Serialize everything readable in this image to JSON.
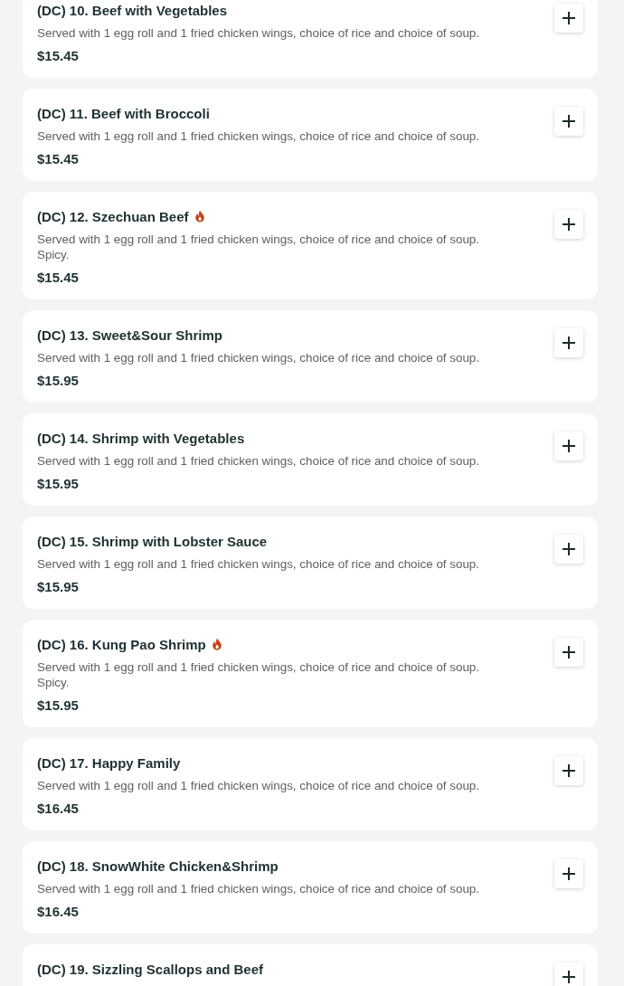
{
  "items": [
    {
      "name": "(DC) 10. Beef with Vegetables",
      "spicy": false,
      "description": "Served with 1 egg roll and 1 fried chicken wings, choice of rice and choice of soup.",
      "price": "$15.45"
    },
    {
      "name": "(DC) 11. Beef with Broccoli",
      "spicy": false,
      "description": "Served with 1 egg roll and 1 fried chicken wings, choice of rice and choice of soup.",
      "price": "$15.45"
    },
    {
      "name": "(DC) 12. Szechuan Beef",
      "spicy": true,
      "description": "Served with 1 egg roll and 1 fried chicken wings, choice of rice and choice of soup.\nSpicy.",
      "price": "$15.45"
    },
    {
      "name": "(DC) 13. Sweet&Sour Shrimp",
      "spicy": false,
      "description": "Served with 1 egg roll and 1 fried chicken wings, choice of rice and choice of soup.",
      "price": "$15.95"
    },
    {
      "name": "(DC) 14. Shrimp with Vegetables",
      "spicy": false,
      "description": "Served with 1 egg roll and 1 fried chicken wings, choice of rice and choice of soup.",
      "price": "$15.95"
    },
    {
      "name": "(DC) 15. Shrimp with Lobster Sauce",
      "spicy": false,
      "description": "Served with 1 egg roll and 1 fried chicken wings, choice of rice and choice of soup.",
      "price": "$15.95"
    },
    {
      "name": "(DC) 16. Kung Pao Shrimp",
      "spicy": true,
      "description": "Served with 1 egg roll and 1 fried chicken wings, choice of rice and choice of soup.\nSpicy.",
      "price": "$15.95"
    },
    {
      "name": "(DC) 17. Happy Family",
      "spicy": false,
      "description": "Served with 1 egg roll and 1 fried chicken wings, choice of rice and choice of soup.",
      "price": "$16.45"
    },
    {
      "name": "(DC) 18. SnowWhite Chicken&Shrimp",
      "spicy": false,
      "description": "Served with 1 egg roll and 1 fried chicken wings, choice of rice and choice of soup.",
      "price": "$16.45"
    },
    {
      "name": "(DC) 19. Sizzling Scallops and Beef",
      "spicy": false
    }
  ]
}
